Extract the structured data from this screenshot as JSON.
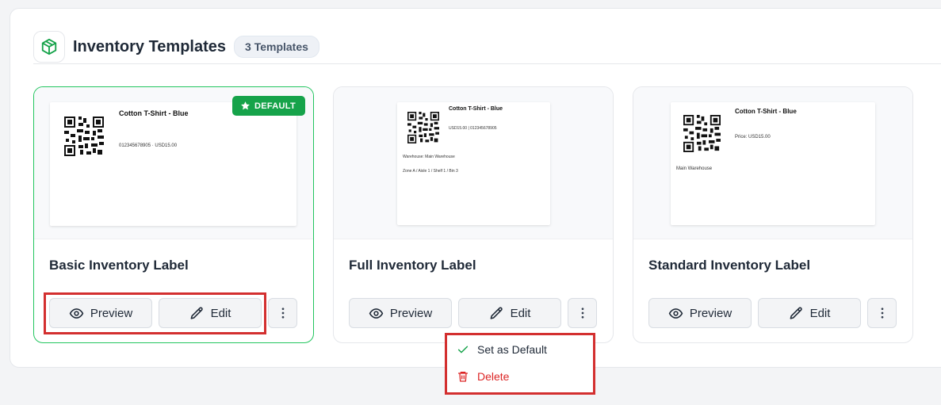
{
  "header": {
    "title": "Inventory Templates",
    "count_badge": "3 Templates",
    "icon": "cube-icon"
  },
  "templates": [
    {
      "name": "Basic Inventory Label",
      "is_default": true,
      "default_badge": "DEFAULT",
      "label": {
        "title": "Cotton T-Shirt - Blue",
        "lines": [
          "012345678905 · USD15.00"
        ]
      },
      "preview_label": "Preview",
      "edit_label": "Edit"
    },
    {
      "name": "Full Inventory Label",
      "is_default": false,
      "label": {
        "title": "Cotton T-Shirt - Blue",
        "lines": [
          "USD15.00 | 012345678905",
          "Warehouse: Main Warehouse",
          "Zone A / Aisle 1 / Shelf 1 / Bin 3"
        ]
      },
      "preview_label": "Preview",
      "edit_label": "Edit"
    },
    {
      "name": "Standard Inventory Label",
      "is_default": false,
      "label": {
        "title": "Cotton T-Shirt - Blue",
        "lines": [
          "Price: USD15.00",
          "Main Warehouse"
        ]
      },
      "preview_label": "Preview",
      "edit_label": "Edit"
    }
  ],
  "context_menu": {
    "set_default_label": "Set as Default",
    "delete_label": "Delete"
  },
  "colors": {
    "accent_green": "#16a34a",
    "danger_red": "#dc2626",
    "highlight_red": "#d32f2f"
  }
}
